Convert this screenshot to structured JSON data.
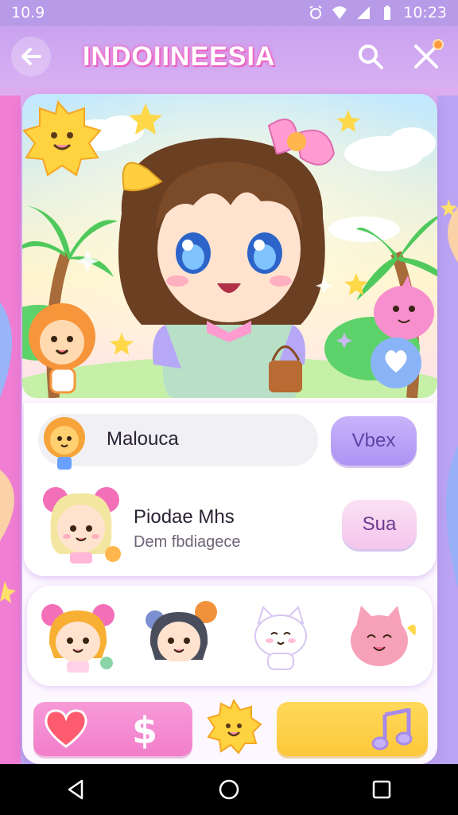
{
  "status_bar": {
    "time_left": "10.9",
    "time_right": "10:23",
    "icons": [
      "alarm-icon",
      "wifi-icon",
      "signal-icon",
      "battery-icon"
    ]
  },
  "app_bar": {
    "title": "INDOIINEESIA",
    "icons": [
      "back-icon",
      "search-icon",
      "close-icon"
    ]
  },
  "list": {
    "row1": {
      "name": "Malouca",
      "button": "Vbex"
    },
    "row2": {
      "name": "Piodae Mhs",
      "subtitle": "Dem fbdiagece",
      "button": "Sua"
    }
  },
  "stickers": [
    "pigtail-girl-sticker",
    "bun-girl-sticker",
    "white-cat-sticker",
    "pink-cat-sticker"
  ],
  "actions": {
    "left_icons": [
      "heart-icon",
      "dollar-icon"
    ],
    "center_icon": "sun-icon",
    "right_icon": "music-note-icon"
  },
  "colors": {
    "accent_purple": "#b79ae8",
    "pink": "#f27ecb",
    "yellow": "#fcc83a",
    "title_glow": "#f46bc8"
  },
  "nav_bar": {
    "icons": [
      "nav-back-icon",
      "nav-home-icon",
      "nav-recents-icon"
    ]
  }
}
